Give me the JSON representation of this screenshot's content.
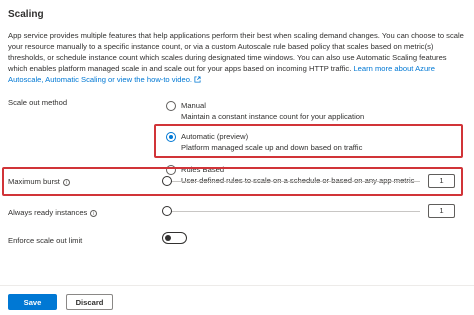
{
  "section": {
    "title": "Scaling",
    "description": "App service provides multiple features that help applications perform their best when scaling demand changes. You can choose to scale your resource manually to a specific instance count, or via a custom Autoscale rule based policy that scales based on metric(s) thresholds, or schedule instance count which scales during designated time windows. You can also use Automatic Scaling features which enables platform managed scale in and scale out for your apps based on incoming HTTP traffic.",
    "link_text": "Learn more about Azure Autoscale, Automatic Scaling or view the how-to video."
  },
  "scale_out": {
    "label": "Scale out method",
    "options": [
      {
        "title": "Manual",
        "description": "Maintain a constant instance count for your application",
        "selected": false
      },
      {
        "title": "Automatic (preview)",
        "description": "Platform managed scale up and down based on traffic",
        "selected": true
      },
      {
        "title": "Rules Based",
        "description": "User defined rules to scale on a schedule or based on any app metric",
        "selected": false
      }
    ]
  },
  "maximum_burst": {
    "label": "Maximum burst",
    "value": "1"
  },
  "always_ready": {
    "label": "Always ready instances",
    "value": "1"
  },
  "enforce_limit": {
    "label": "Enforce scale out limit",
    "enabled": false
  },
  "buttons": {
    "save": "Save",
    "discard": "Discard"
  },
  "colors": {
    "accent": "#0078d4",
    "highlight": "#d13438",
    "text": "#323130"
  }
}
